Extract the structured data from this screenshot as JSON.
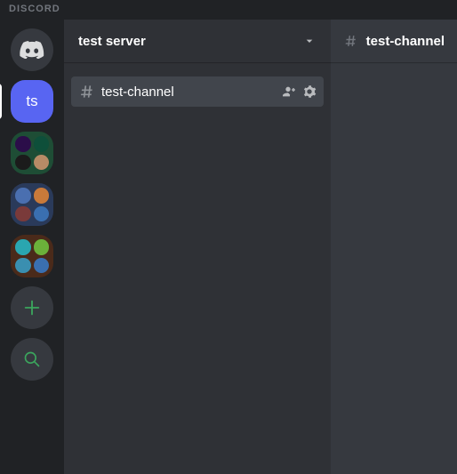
{
  "app": {
    "name": "DISCORD"
  },
  "serverRail": {
    "selectedAbbr": "ts",
    "folders": [
      {
        "bg": "#1e4d35",
        "dots": [
          "#2b0d49",
          "#0e4f3a",
          "#1b1b1b",
          "#b88b66"
        ]
      },
      {
        "bg": "#2a3a5a",
        "dots": [
          "#4a6fb0",
          "#c97a3a",
          "#7a3a3a",
          "#3a6fb0"
        ]
      },
      {
        "bg": "#4a2a1a",
        "dots": [
          "#2aa6b0",
          "#6bb03a",
          "#3a8fb0",
          "#3a6fb0"
        ]
      }
    ]
  },
  "colors": {
    "accentGreen": "#3ba55d"
  },
  "server": {
    "name": "test server"
  },
  "channel": {
    "selected": {
      "name": "test-channel"
    }
  },
  "chat": {
    "title": "test-channel"
  }
}
